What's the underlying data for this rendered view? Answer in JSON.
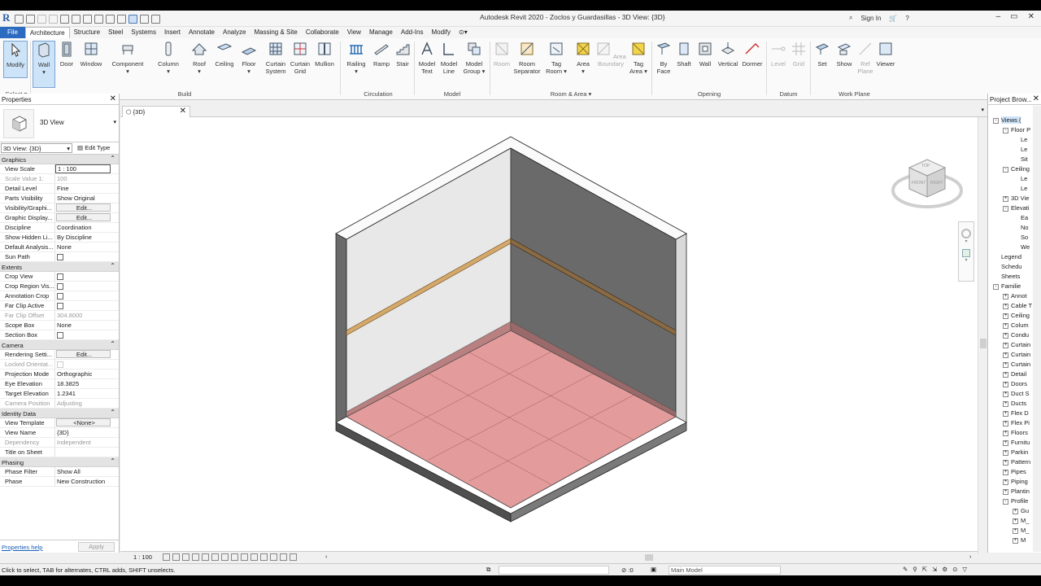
{
  "app": {
    "title": "Autodesk Revit 2020 - Zoclos y Guardasillas - 3D View: {3D}",
    "sign_in": "Sign In"
  },
  "tabs": [
    "File",
    "Architecture",
    "Structure",
    "Steel",
    "Systems",
    "Insert",
    "Annotate",
    "Analyze",
    "Massing & Site",
    "Collaborate",
    "View",
    "Manage",
    "Add-Ins",
    "Modify"
  ],
  "active_tab": "Architecture",
  "ribbon": {
    "select": {
      "modify": "Modify",
      "select_label": "Select"
    },
    "build": {
      "label": "Build",
      "buttons": [
        "Wall",
        "Door",
        "Window",
        "Component",
        "Column",
        "Roof",
        "Ceiling",
        "Floor",
        "Curtain System",
        "Curtain Grid",
        "Mullion"
      ]
    },
    "circulation": {
      "label": "Circulation",
      "buttons": [
        "Railing",
        "Ramp",
        "Stair"
      ]
    },
    "model": {
      "label": "Model",
      "buttons": [
        "Model Text",
        "Model Line",
        "Model Group"
      ]
    },
    "room_area": {
      "label": "Room & Area",
      "buttons": [
        "Room",
        "Room Separator",
        "Tag Room",
        "Area",
        "Area Boundary",
        "Tag Area"
      ]
    },
    "opening": {
      "label": "Opening",
      "buttons": [
        "By Face",
        "Shaft",
        "Wall",
        "Vertical",
        "Dormer"
      ]
    },
    "datum": {
      "label": "Datum",
      "buttons": [
        "Level",
        "Grid"
      ]
    },
    "work_plane": {
      "label": "Work Plane",
      "buttons": [
        "Set",
        "Show",
        "Ref Plane",
        "Viewer"
      ]
    }
  },
  "properties": {
    "title": "Properties",
    "type_name": "3D View",
    "instance": "3D View: {3D}",
    "edit_type": "Edit Type",
    "groups": [
      {
        "name": "Graphics",
        "rows": [
          [
            "View Scale",
            "1 : 100"
          ],
          [
            "Scale Value    1:",
            "100"
          ],
          [
            "Detail Level",
            "Fine"
          ],
          [
            "Parts Visibility",
            "Show Original"
          ],
          [
            "Visibility/Graphi...",
            "Edit..."
          ],
          [
            "Graphic Display...",
            "Edit..."
          ],
          [
            "Discipline",
            "Coordination"
          ],
          [
            "Show Hidden Li...",
            "By Discipline"
          ],
          [
            "Default Analysis...",
            "None"
          ],
          [
            "Sun Path",
            ""
          ]
        ]
      },
      {
        "name": "Extents",
        "rows": [
          [
            "Crop View",
            ""
          ],
          [
            "Crop Region Vis...",
            ""
          ],
          [
            "Annotation Crop",
            ""
          ],
          [
            "Far Clip Active",
            ""
          ],
          [
            "Far Clip Offset",
            "304.8000"
          ],
          [
            "Scope Box",
            "None"
          ],
          [
            "Section Box",
            ""
          ]
        ]
      },
      {
        "name": "Camera",
        "rows": [
          [
            "Rendering Setti...",
            "Edit..."
          ],
          [
            "Locked Orientat...",
            ""
          ],
          [
            "Projection Mode",
            "Orthographic"
          ],
          [
            "Eye Elevation",
            "18.3825"
          ],
          [
            "Target Elevation",
            "1.2341"
          ],
          [
            "Camera Position",
            "Adjusting"
          ]
        ]
      },
      {
        "name": "Identity Data",
        "rows": [
          [
            "View Template",
            "<None>"
          ],
          [
            "View Name",
            "{3D}"
          ],
          [
            "Dependency",
            "Independent"
          ],
          [
            "Title on Sheet",
            ""
          ]
        ]
      },
      {
        "name": "Phasing",
        "rows": [
          [
            "Phase Filter",
            "Show All"
          ],
          [
            "Phase",
            "New Construction"
          ]
        ]
      }
    ],
    "help": "Properties help",
    "apply": "Apply"
  },
  "view": {
    "tab_label": "{3D}",
    "scale": "1 : 100",
    "viewcube": {
      "top": "TOP",
      "front": "FRONT",
      "right": "RIGHT"
    }
  },
  "browser": {
    "title": "Project Brow...",
    "items": [
      {
        "label": "Views (",
        "indent": 0,
        "sign": "-"
      },
      {
        "label": "Floor P",
        "indent": 1,
        "sign": "-"
      },
      {
        "label": "Le",
        "indent": 2,
        "sign": ""
      },
      {
        "label": "Le",
        "indent": 2,
        "sign": ""
      },
      {
        "label": "Sit",
        "indent": 2,
        "sign": ""
      },
      {
        "label": "Ceiling",
        "indent": 1,
        "sign": "-"
      },
      {
        "label": "Le",
        "indent": 2,
        "sign": ""
      },
      {
        "label": "Le",
        "indent": 2,
        "sign": ""
      },
      {
        "label": "3D Vie",
        "indent": 1,
        "sign": "+"
      },
      {
        "label": "Elevati",
        "indent": 1,
        "sign": "-"
      },
      {
        "label": "Ea",
        "indent": 2,
        "sign": ""
      },
      {
        "label": "No",
        "indent": 2,
        "sign": ""
      },
      {
        "label": "So",
        "indent": 2,
        "sign": ""
      },
      {
        "label": "We",
        "indent": 2,
        "sign": ""
      },
      {
        "label": "Legend",
        "indent": 0,
        "sign": ""
      },
      {
        "label": "Schedu",
        "indent": 0,
        "sign": ""
      },
      {
        "label": "Sheets",
        "indent": 0,
        "sign": ""
      },
      {
        "label": "Familie",
        "indent": 0,
        "sign": "-"
      },
      {
        "label": "Annot",
        "indent": 1,
        "sign": "+"
      },
      {
        "label": "Cable T",
        "indent": 1,
        "sign": "+"
      },
      {
        "label": "Ceiling",
        "indent": 1,
        "sign": "+"
      },
      {
        "label": "Colum",
        "indent": 1,
        "sign": "+"
      },
      {
        "label": "Condu",
        "indent": 1,
        "sign": "+"
      },
      {
        "label": "Curtain",
        "indent": 1,
        "sign": "+"
      },
      {
        "label": "Curtain",
        "indent": 1,
        "sign": "+"
      },
      {
        "label": "Curtain",
        "indent": 1,
        "sign": "+"
      },
      {
        "label": "Detail",
        "indent": 1,
        "sign": "+"
      },
      {
        "label": "Doors",
        "indent": 1,
        "sign": "+"
      },
      {
        "label": "Duct S",
        "indent": 1,
        "sign": "+"
      },
      {
        "label": "Ducts",
        "indent": 1,
        "sign": "+"
      },
      {
        "label": "Flex D",
        "indent": 1,
        "sign": "+"
      },
      {
        "label": "Flex Pi",
        "indent": 1,
        "sign": "+"
      },
      {
        "label": "Floors",
        "indent": 1,
        "sign": "+"
      },
      {
        "label": "Furnitu",
        "indent": 1,
        "sign": "+"
      },
      {
        "label": "Parkin",
        "indent": 1,
        "sign": "+"
      },
      {
        "label": "Pattern",
        "indent": 1,
        "sign": "+"
      },
      {
        "label": "Pipes",
        "indent": 1,
        "sign": "+"
      },
      {
        "label": "Piping",
        "indent": 1,
        "sign": "+"
      },
      {
        "label": "Plantin",
        "indent": 1,
        "sign": "+"
      },
      {
        "label": "Profile",
        "indent": 1,
        "sign": "-"
      },
      {
        "label": "Gu",
        "indent": 2,
        "sign": "+"
      },
      {
        "label": "M_",
        "indent": 2,
        "sign": "+"
      },
      {
        "label": "M_",
        "indent": 2,
        "sign": "+"
      },
      {
        "label": "M",
        "indent": 2,
        "sign": "+"
      }
    ]
  },
  "status": {
    "message": "Click to select, TAB for alternates, CTRL adds, SHIFT unselects.",
    "zero": ":0",
    "model": "Main Model"
  },
  "colors": {
    "floor": "#e39b9b",
    "wall_light": "#e8e8e8",
    "wall_dark": "#6a6a6a",
    "handrail": "#d3a86a",
    "accent": "#2c6bc0"
  }
}
